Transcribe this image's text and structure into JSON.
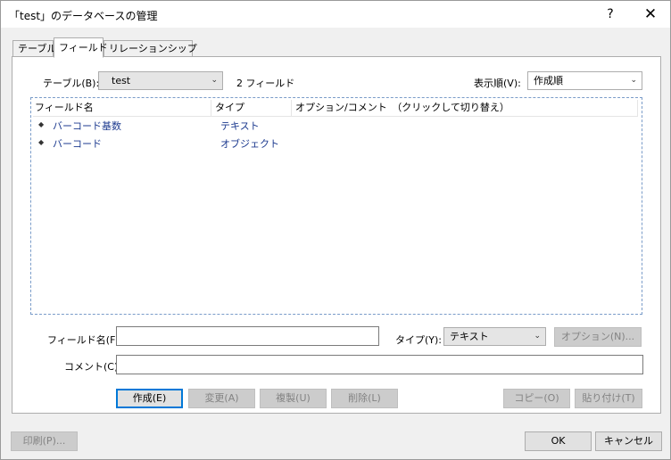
{
  "window": {
    "title": "「test」のデータベースの管理",
    "help_glyph": "?",
    "close_glyph": "✕"
  },
  "tabs": [
    {
      "label": "テーブル"
    },
    {
      "label": "フィールド"
    },
    {
      "label": "リレーションシップ"
    }
  ],
  "table_selector": {
    "label": "テーブル(B):",
    "value": "test",
    "field_count": "2 フィールド"
  },
  "sort_selector": {
    "label": "表示順(V):",
    "value": "作成順"
  },
  "field_list": {
    "columns": [
      "フィールド名",
      "タイプ",
      "オプション/コメント　（クリックして切り替え）"
    ],
    "rows": [
      {
        "name": "バーコード基数",
        "type": "テキスト"
      },
      {
        "name": "バーコード",
        "type": "オブジェクト"
      }
    ]
  },
  "field_form": {
    "name_label": "フィールド名(F):",
    "name_value": "",
    "type_label": "タイプ(Y):",
    "type_value": "テキスト",
    "options_button": "オプション(N)...",
    "comment_label": "コメント(C):",
    "comment_value": ""
  },
  "actions": {
    "create": "作成(E)",
    "change": "変更(A)",
    "duplicate": "複製(U)",
    "delete": "削除(L)",
    "copy": "コピー(O)",
    "paste": "貼り付け(T)"
  },
  "footer": {
    "print": "印刷(P)...",
    "ok": "OK",
    "cancel": "キャンセル"
  }
}
